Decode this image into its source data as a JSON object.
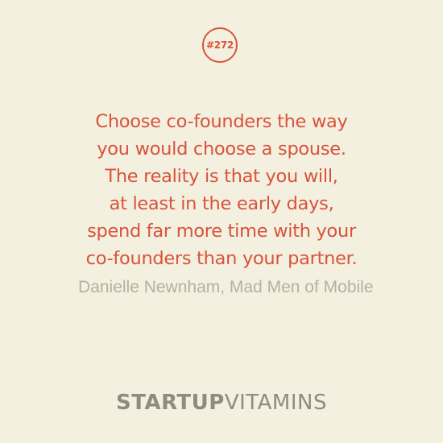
{
  "badge": {
    "number": "#272"
  },
  "quote": {
    "lines": [
      "Choose co-founders the way",
      "you would choose a spouse.",
      "The reality is that you will,",
      "at least in the early days,",
      "spend far more time with your",
      "co-founders than your partner."
    ]
  },
  "attribution": "Danielle Newnham, Mad Men of Mobile",
  "brand": {
    "part1": "STARTUP",
    "part2": "VITAMINS"
  },
  "colors": {
    "background": "#f4f0e0",
    "accent": "#d8533b",
    "attribution_text": "#b5b1a2",
    "brand_text": "#8e8b81"
  }
}
